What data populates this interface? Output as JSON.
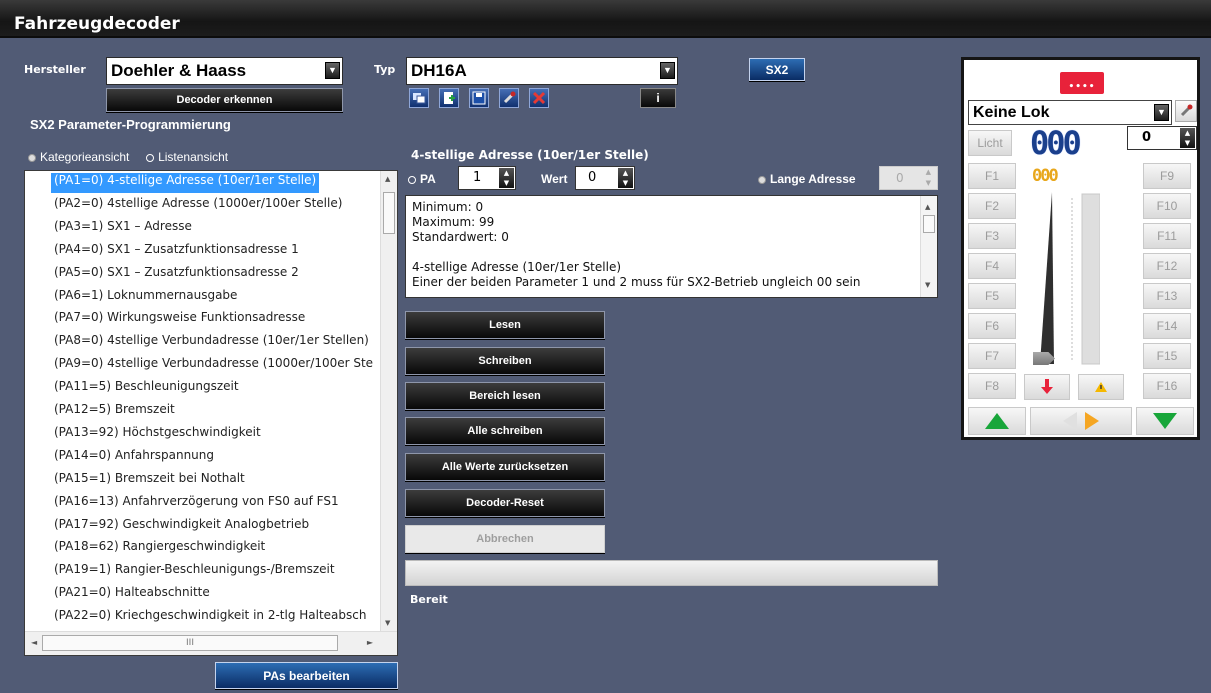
{
  "window": {
    "title": "Fahrzeugdecoder"
  },
  "hersteller": {
    "label": "Hersteller",
    "value": "Doehler & Haass"
  },
  "typ": {
    "label": "Typ",
    "value": "DH16A"
  },
  "buttons": {
    "decoder_erkennen": "Decoder erkennen",
    "sx2": "SX2",
    "pas_bearbeiten": "PAs bearbeiten",
    "info_icon": "i"
  },
  "section_title": "SX2 Parameter-Programmierung",
  "views": {
    "kategorie": "Kategorieansicht",
    "liste": "Listenansicht",
    "selected": "Listenansicht"
  },
  "param_list": [
    "(PA1=0) 4-stellige Adresse (10er/1er Stelle)",
    "(PA2=0) 4stellige Adresse (1000er/100er Stelle)",
    "(PA3=1) SX1 – Adresse",
    "(PA4=0) SX1 – Zusatzfunktionsadresse 1",
    "(PA5=0) SX1 – Zusatzfunktionsadresse 2",
    "(PA6=1) Loknummernausgabe",
    "(PA7=0) Wirkungsweise Funktionsadresse",
    "(PA8=0) 4stellige Verbundadresse (10er/1er Stellen)",
    "(PA9=0) 4stellige Verbundadresse (1000er/100er Ste",
    "(PA11=5) Beschleunigungszeit",
    "(PA12=5) Bremszeit",
    "(PA13=92) Höchstgeschwindigkeit",
    "(PA14=0) Anfahrspannung",
    "(PA15=1) Bremszeit bei Nothalt",
    "(PA16=13) Anfahrverzögerung von FS0 auf FS1",
    "(PA17=92) Geschwindigkeit Analogbetrieb",
    "(PA18=62) Rangiergeschwindigkeit",
    "(PA19=1) Rangier-Beschleunigungs-/Bremszeit",
    "(PA21=0) Halteabschnitte",
    "(PA22=0) Kriechgeschwindigkeit in 2-tlg Halteabsch"
  ],
  "hscroll_label": "III",
  "param_detail": {
    "heading": "4-stellige Adresse (10er/1er Stelle)",
    "pa_label": "PA",
    "pa_value": "1",
    "wert_label": "Wert",
    "wert_value": "0",
    "lange_label": "Lange Adresse",
    "lange_value": "0",
    "info_lines": [
      "Minimum: 0",
      "Maximum: 99",
      "Standardwert: 0",
      "",
      "4-stellige Adresse (10er/1er Stelle)",
      "Einer der beiden Parameter 1 und 2 muss für SX2-Betrieb ungleich 00 sein"
    ]
  },
  "actions": [
    "Lesen",
    "Schreiben",
    "Bereich lesen",
    "Alle schreiben",
    "Alle Werte zurücksetzen",
    "Decoder-Reset"
  ],
  "abbrechen": "Abbrechen",
  "progress": {
    "value": 0,
    "status": "Bereit"
  },
  "lok": {
    "name": "Keine Lok",
    "licht": "Licht",
    "address": "000",
    "speedstep": "0",
    "speed_display": "000",
    "dots": "••••",
    "functions_left": [
      "F1",
      "F2",
      "F3",
      "F4",
      "F5",
      "F6",
      "F7",
      "F8"
    ],
    "functions_right": [
      "F9",
      "F10",
      "F11",
      "F12",
      "F13",
      "F14",
      "F15",
      "F16"
    ],
    "slider_value": 0
  },
  "colors": {
    "background": "#515b75",
    "selection": "#3399ff",
    "lok_red": "#e8223a",
    "green": "#18a63a",
    "orange": "#f5a623"
  }
}
